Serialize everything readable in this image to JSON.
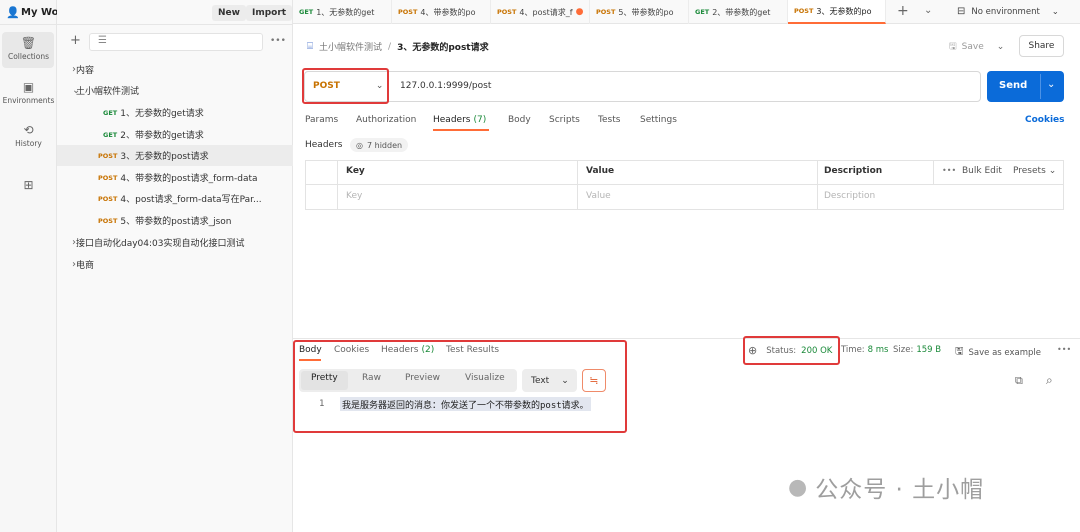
{
  "workspace": {
    "name": "My Workspace",
    "new_label": "New",
    "import_label": "Import"
  },
  "rail": {
    "items": [
      {
        "label": "Collections",
        "icon": "collections-icon"
      },
      {
        "label": "Environments",
        "icon": "environments-icon"
      },
      {
        "label": "History",
        "icon": "history-icon"
      },
      {
        "label": "",
        "icon": "apps-icon"
      }
    ]
  },
  "tree": [
    {
      "label": "内容",
      "type": "folder",
      "state": "collapsed"
    },
    {
      "label": "土小帽软件测试",
      "type": "folder",
      "state": "expanded"
    },
    {
      "method": "GET",
      "label": "1、无参数的get请求"
    },
    {
      "method": "GET",
      "label": "2、带参数的get请求"
    },
    {
      "method": "POST",
      "label": "3、无参数的post请求",
      "selected": true
    },
    {
      "method": "POST",
      "label": "4、带参数的post请求_form-data"
    },
    {
      "method": "POST",
      "label": "4、post请求_form-data写在Par..."
    },
    {
      "method": "POST",
      "label": "5、带参数的post请求_json"
    },
    {
      "label": "接口自动化day04:03实现自动化接口测试",
      "type": "folder",
      "state": "collapsed"
    },
    {
      "label": "电商",
      "type": "folder",
      "state": "collapsed"
    }
  ],
  "tabs": [
    {
      "method": "GET",
      "label": "1、无参数的get"
    },
    {
      "method": "POST",
      "label": "4、带参数的po"
    },
    {
      "method": "POST",
      "label": "4、post请求_f",
      "dirty": true
    },
    {
      "method": "POST",
      "label": "5、带参数的po"
    },
    {
      "method": "GET",
      "label": "2、带参数的get"
    },
    {
      "method": "POST",
      "label": "3、无参数的po",
      "active": true
    }
  ],
  "environment": "No environment",
  "breadcrumb": {
    "parent": "土小帽软件测试",
    "separator": "/",
    "current": "3、无参数的post请求"
  },
  "actions": {
    "save": "Save",
    "share": "Share"
  },
  "request": {
    "method": "POST",
    "url": "127.0.0.1:9999/post",
    "send": "Send"
  },
  "request_tabs": {
    "params": "Params",
    "authorization": "Authorization",
    "headers": "Headers",
    "headers_count": "(7)",
    "body": "Body",
    "scripts": "Scripts",
    "tests": "Tests",
    "settings": "Settings",
    "cookies": "Cookies"
  },
  "headers_section": {
    "title": "Headers",
    "hidden": "7 hidden",
    "col_key": "Key",
    "col_value": "Value",
    "col_description": "Description",
    "bulk_edit": "Bulk Edit",
    "presets": "Presets",
    "ph_key": "Key",
    "ph_value": "Value",
    "ph_description": "Description"
  },
  "response": {
    "body": "Body",
    "cookies": "Cookies",
    "headers": "Headers",
    "headers_count": "(2)",
    "test_results": "Test Results",
    "status_label": "Status:",
    "status_value": "200 OK",
    "time_label": "Time:",
    "time_value": "8 ms",
    "size_label": "Size:",
    "size_value": "159 B",
    "save_example": "Save as example",
    "formats": [
      "Pretty",
      "Raw",
      "Preview",
      "Visualize"
    ],
    "type": "Text",
    "line_no": "1",
    "content": "我是服务器返回的消息：你发送了一个不带参数的post请求。"
  },
  "watermark": "公众号 · 土小帽",
  "colors": {
    "accent": "#ff6c37",
    "send": "#0b6bd9",
    "get": "#1b8a3a",
    "post": "#c77200",
    "status_ok": "#1b8a3a",
    "highlight": "#e03a3a"
  }
}
